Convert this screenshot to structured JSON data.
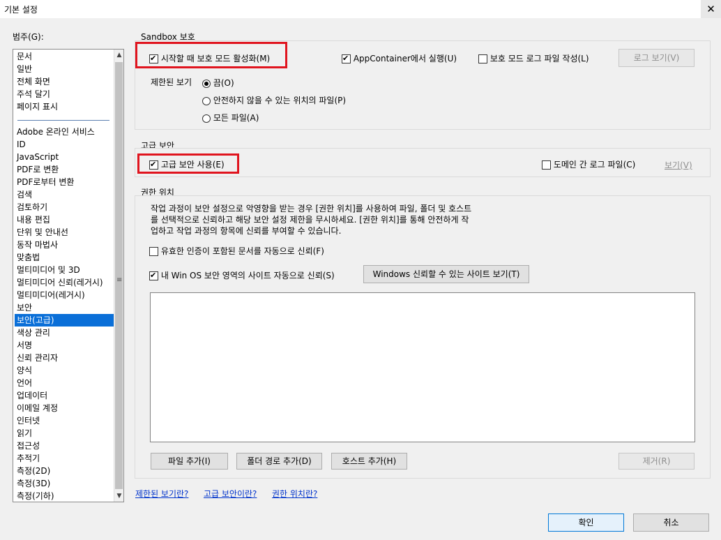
{
  "window": {
    "title": "기본 설정",
    "close_icon": "close-icon"
  },
  "categories": {
    "label": "범주(G):",
    "top_items": [
      "문서",
      "일반",
      "전체 화면",
      "주석 달기",
      "페이지 표시"
    ],
    "items": [
      "Adobe 온라인 서비스",
      "ID",
      "JavaScript",
      "PDF로 변환",
      "PDF로부터 변환",
      "검색",
      "검토하기",
      "내용 편집",
      "단위 및 안내선",
      "동작 마법사",
      "맞춤법",
      "멀티미디어 및 3D",
      "멀티미디어 신뢰(레거시)",
      "멀티미디어(레거시)",
      "보안",
      "보안(고급)",
      "색상 관리",
      "서명",
      "신뢰 관리자",
      "양식",
      "언어",
      "업데이터",
      "이메일 계정",
      "인터넷",
      "읽기",
      "접근성",
      "추적기",
      "측정(2D)",
      "측정(3D)",
      "측정(기하)"
    ],
    "selected": "보안(고급)"
  },
  "sandbox": {
    "title": "Sandbox 보호",
    "protected_mode": {
      "label": "시작할 때 보호 모드 활성화(M)",
      "checked": true
    },
    "app_container": {
      "label": "AppContainer에서 실행(U)",
      "checked": true
    },
    "log_file": {
      "label": "보호 모드 로그 파일 작성(L)",
      "checked": false
    },
    "view_log_button": "로그 보기(V)",
    "protected_view": {
      "label": "제한된 보기",
      "options": [
        "끔(O)",
        "안전하지 않을 수 있는 위치의 파일(P)",
        "모든 파일(A)"
      ],
      "selected_index": 0
    }
  },
  "enhanced": {
    "title": "고급 보안",
    "enable": {
      "label": "고급 보안 사용(E)",
      "checked": true
    },
    "cross_domain": {
      "label": "도메인 간 로그 파일(C)",
      "checked": false
    },
    "view_link": "보기(V)"
  },
  "privileged": {
    "title": "권한 위치",
    "desc_lines": [
      "작업 과정이 보안 설정으로 악영향을 받는 경우 [권한 위치]를 사용하여 파일, 폴더 및 호스트",
      "를 선택적으로 신뢰하고 해당 보안 설정 제한을 무시하세요. [권한 위치]를 통해 안전하게 작",
      "업하고 작업 과정의 항목에 신뢰를 부여할 수 있습니다."
    ],
    "trust_certified": {
      "label": "유효한 인증이 포함된 문서를 자동으로 신뢰(F)",
      "checked": false
    },
    "trust_os": {
      "label": "내 Win OS 보안 영역의 사이트 자동으로 신뢰(S)",
      "checked": true
    },
    "view_sites_button": "Windows 신뢰할 수 있는 사이트 보기(T)",
    "add_file_button": "파일 추가(I)",
    "add_folder_button": "폴더 경로 추가(D)",
    "add_host_button": "호스트 추가(H)",
    "remove_button": "제거(R)"
  },
  "help_links": [
    "제한된 보기란?",
    "고급 보안이란?",
    "권한 위치란?"
  ],
  "footer": {
    "ok": "확인",
    "cancel": "취소"
  },
  "colors": {
    "selection": "#0a6fd8",
    "highlight_box": "#e0141e",
    "link": "#0033cc"
  }
}
